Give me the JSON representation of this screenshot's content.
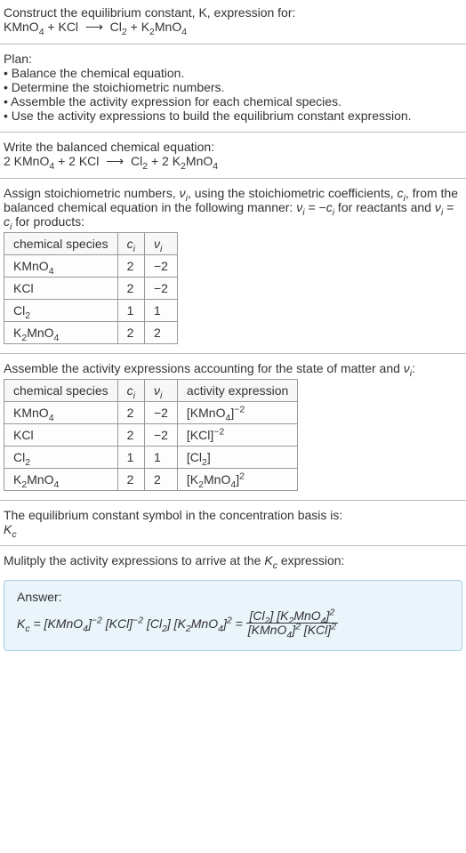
{
  "intro": {
    "line1": "Construct the equilibrium constant, K, expression for:",
    "line2_html": "KMnO<sub>4</sub> + KCl &nbsp;⟶&nbsp; Cl<sub>2</sub> + K<sub>2</sub>MnO<sub>4</sub>"
  },
  "plan": {
    "header": "Plan:",
    "items": [
      "• Balance the chemical equation.",
      "• Determine the stoichiometric numbers.",
      "• Assemble the activity expression for each chemical species.",
      "• Use the activity expressions to build the equilibrium constant expression."
    ]
  },
  "balanced": {
    "line1": "Write the balanced chemical equation:",
    "line2_html": "2 KMnO<sub>4</sub> + 2 KCl &nbsp;⟶&nbsp; Cl<sub>2</sub> + 2 K<sub>2</sub>MnO<sub>4</sub>"
  },
  "assign": {
    "text_html": "Assign stoichiometric numbers, <span class='it'>ν<sub>i</sub></span>, using the stoichiometric coefficients, <span class='it'>c<sub>i</sub></span>, from the balanced chemical equation in the following manner: <span class='it'>ν<sub>i</sub></span> = −<span class='it'>c<sub>i</sub></span> for reactants and <span class='it'>ν<sub>i</sub></span> = <span class='it'>c<sub>i</sub></span> for products:",
    "headers_html": [
      "chemical species",
      "<span class='it'>c<sub>i</sub></span>",
      "<span class='it'>ν<sub>i</sub></span>"
    ],
    "rows_html": [
      [
        "KMnO<sub>4</sub>",
        "2",
        "−2"
      ],
      [
        "KCl",
        "2",
        "−2"
      ],
      [
        "Cl<sub>2</sub>",
        "1",
        "1"
      ],
      [
        "K<sub>2</sub>MnO<sub>4</sub>",
        "2",
        "2"
      ]
    ]
  },
  "activity": {
    "text_html": "Assemble the activity expressions accounting for the state of matter and <span class='it'>ν<sub>i</sub></span>:",
    "headers_html": [
      "chemical species",
      "<span class='it'>c<sub>i</sub></span>",
      "<span class='it'>ν<sub>i</sub></span>",
      "activity expression"
    ],
    "rows_html": [
      [
        "KMnO<sub>4</sub>",
        "2",
        "−2",
        "[KMnO<sub>4</sub>]<sup>−2</sup>"
      ],
      [
        "KCl",
        "2",
        "−2",
        "[KCl]<sup>−2</sup>"
      ],
      [
        "Cl<sub>2</sub>",
        "1",
        "1",
        "[Cl<sub>2</sub>]"
      ],
      [
        "K<sub>2</sub>MnO<sub>4</sub>",
        "2",
        "2",
        "[K<sub>2</sub>MnO<sub>4</sub>]<sup>2</sup>"
      ]
    ]
  },
  "symbol": {
    "line1": "The equilibrium constant symbol in the concentration basis is:",
    "line2_html": "<span class='it'>K<sub>c</sub></span>"
  },
  "multiply": {
    "text_html": "Mulitply the activity expressions to arrive at the <span class='it'>K<sub>c</sub></span> expression:"
  },
  "answer": {
    "label": "Answer:",
    "kc_html": "<span class='it'>K<sub>c</sub></span> = [KMnO<sub>4</sub>]<sup>−2</sup> [KCl]<sup>−2</sup> [Cl<sub>2</sub>] [K<sub>2</sub>MnO<sub>4</sub>]<sup>2</sup> = ",
    "frac_num_html": "[Cl<sub>2</sub>] [K<sub>2</sub>MnO<sub>4</sub>]<sup>2</sup>",
    "frac_den_html": "[KMnO<sub>4</sub>]<sup>2</sup> [KCl]<sup>2</sup>"
  }
}
